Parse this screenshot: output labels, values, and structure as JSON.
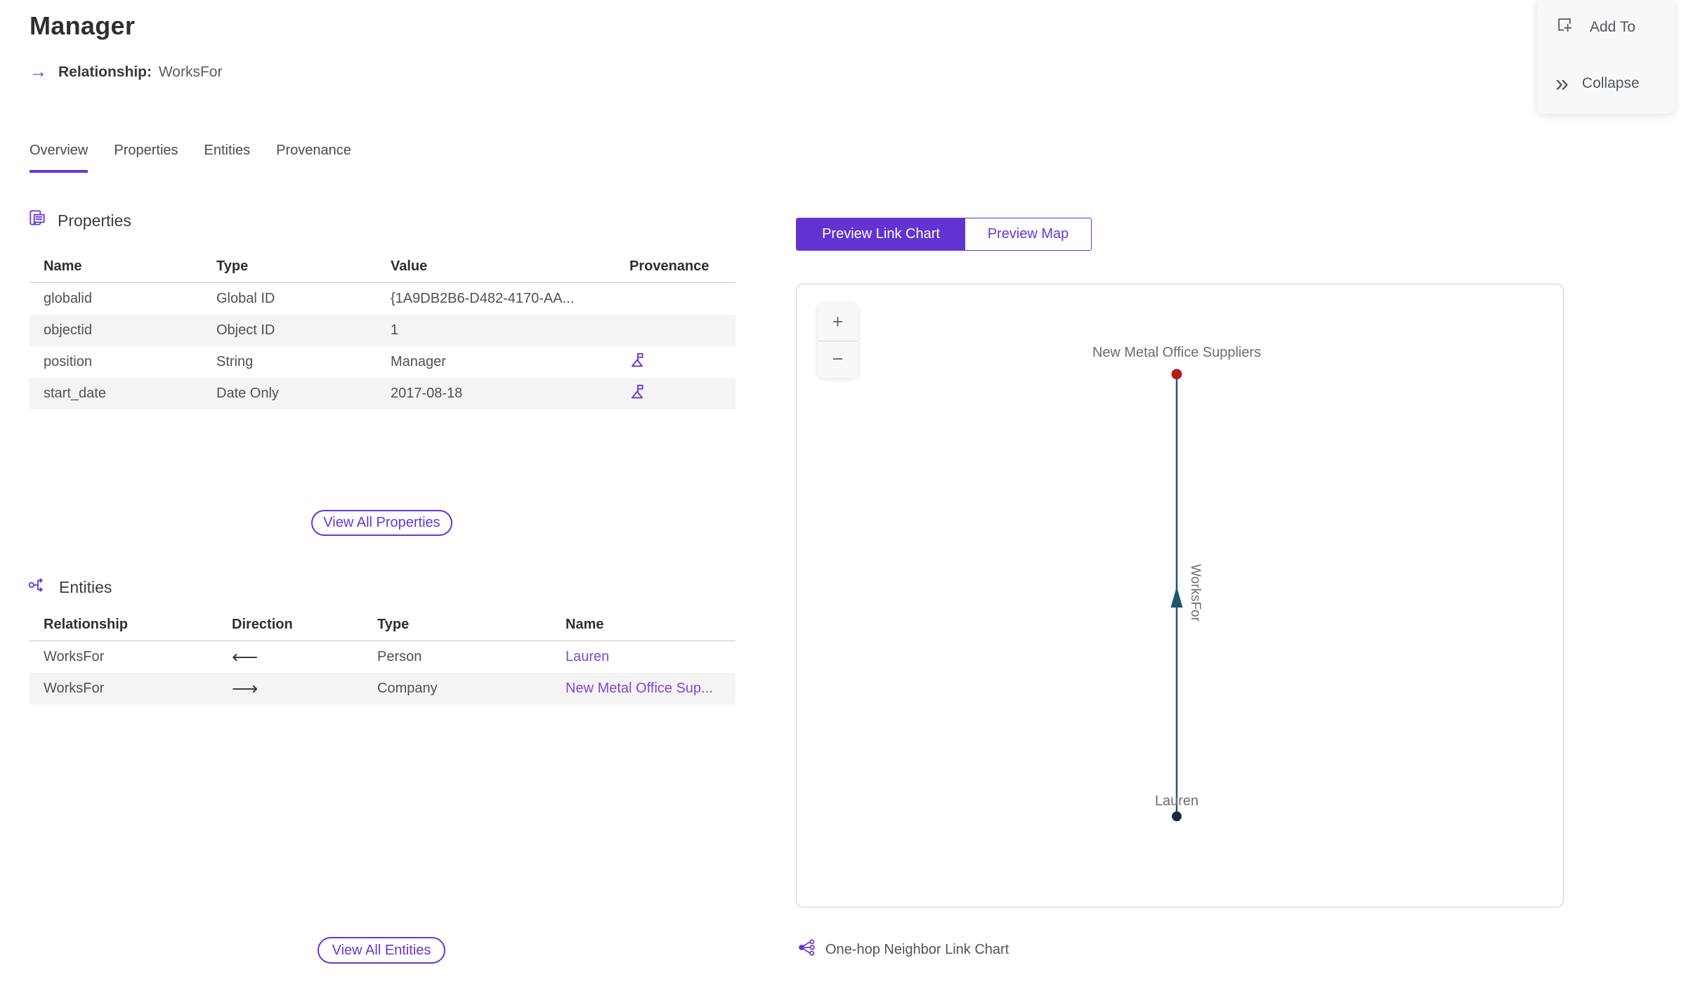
{
  "colors": {
    "accent": "#6a35d4",
    "link": "#7a4bd6",
    "edge": "#1f576b",
    "top_node": "#b71c1c",
    "bottom_node": "#1b2940"
  },
  "header": {
    "title": "Manager",
    "relationship_arrow_icon": "→",
    "relationship_label": "Relationship:",
    "relationship_value": "WorksFor"
  },
  "floating_actions": {
    "add_to_label": "Add To",
    "collapse_label": "Collapse",
    "collapse_icon": "»"
  },
  "tabs": [
    {
      "label": "Overview"
    },
    {
      "label": "Properties"
    },
    {
      "label": "Entities"
    },
    {
      "label": "Provenance"
    }
  ],
  "properties_section": {
    "title": "Properties",
    "columns": {
      "name": "Name",
      "type": "Type",
      "value": "Value",
      "provenance": "Provenance"
    },
    "rows": [
      {
        "name": "globalid",
        "type": "Global ID",
        "value": "{1A9DB2B6-D482-4170-AA..."
      },
      {
        "name": "objectid",
        "type": "Object ID",
        "value": "1"
      },
      {
        "name": "position",
        "type": "String",
        "value": "Manager"
      },
      {
        "name": "start_date",
        "type": "Date Only",
        "value": "2017-08-18"
      }
    ],
    "view_all_label": "View All Properties"
  },
  "entities_section": {
    "title": "Entities",
    "columns": {
      "relationship": "Relationship",
      "direction": "Direction",
      "type": "Type",
      "name": "Name"
    },
    "rows": [
      {
        "relationship": "WorksFor",
        "direction": "⟵",
        "type": "Person",
        "name": "Lauren"
      },
      {
        "relationship": "WorksFor",
        "direction": "⟶",
        "type": "Company",
        "name": "New Metal Office Sup..."
      }
    ],
    "view_all_label": "View All Entities"
  },
  "preview": {
    "segments": {
      "link_chart": "Preview Link Chart",
      "map": "Preview Map"
    },
    "zoom_in": "+",
    "zoom_out": "−",
    "graph": {
      "top_node_label": "New Metal Office Suppliers",
      "edge_label": "WorksFor",
      "bottom_node_label": "Lauren"
    },
    "caption": "One-hop Neighbor Link Chart"
  }
}
